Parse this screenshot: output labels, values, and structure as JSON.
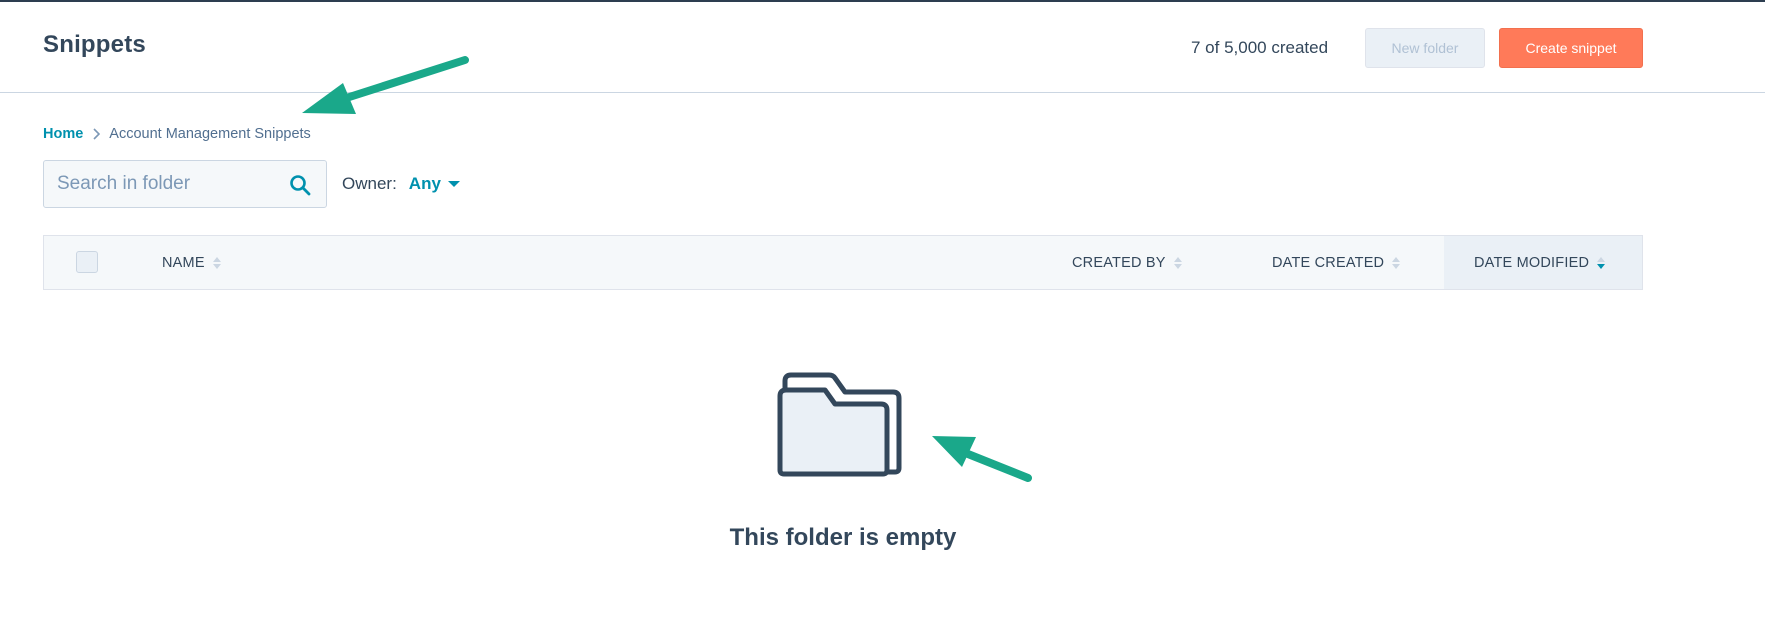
{
  "header": {
    "title": "Snippets",
    "created_count": "7 of 5,000 created",
    "new_folder_label": "New folder",
    "create_snippet_label": "Create snippet"
  },
  "breadcrumb": {
    "home": "Home",
    "current": "Account Management Snippets"
  },
  "search": {
    "placeholder": "Search in folder",
    "value": ""
  },
  "owner_filter": {
    "label": "Owner:",
    "value": "Any"
  },
  "table": {
    "columns": [
      "NAME",
      "CREATED BY",
      "DATE CREATED",
      "DATE MODIFIED"
    ],
    "active_sort_column": "DATE MODIFIED",
    "active_sort_direction": "descending"
  },
  "empty_state": {
    "message": "This folder is empty"
  },
  "colors": {
    "accent_teal": "#0091ae",
    "primary_button": "#ff7a59",
    "text_dark": "#33475b",
    "annotation_arrow": "#1aa88a"
  },
  "icons": {
    "search": "search-icon",
    "breadcrumb_separator": "chevron-right-icon",
    "owner_dropdown": "caret-down-icon",
    "sort": "sort-icon",
    "empty_state": "folder-icon",
    "annotations": "annotation-arrow-icon"
  }
}
